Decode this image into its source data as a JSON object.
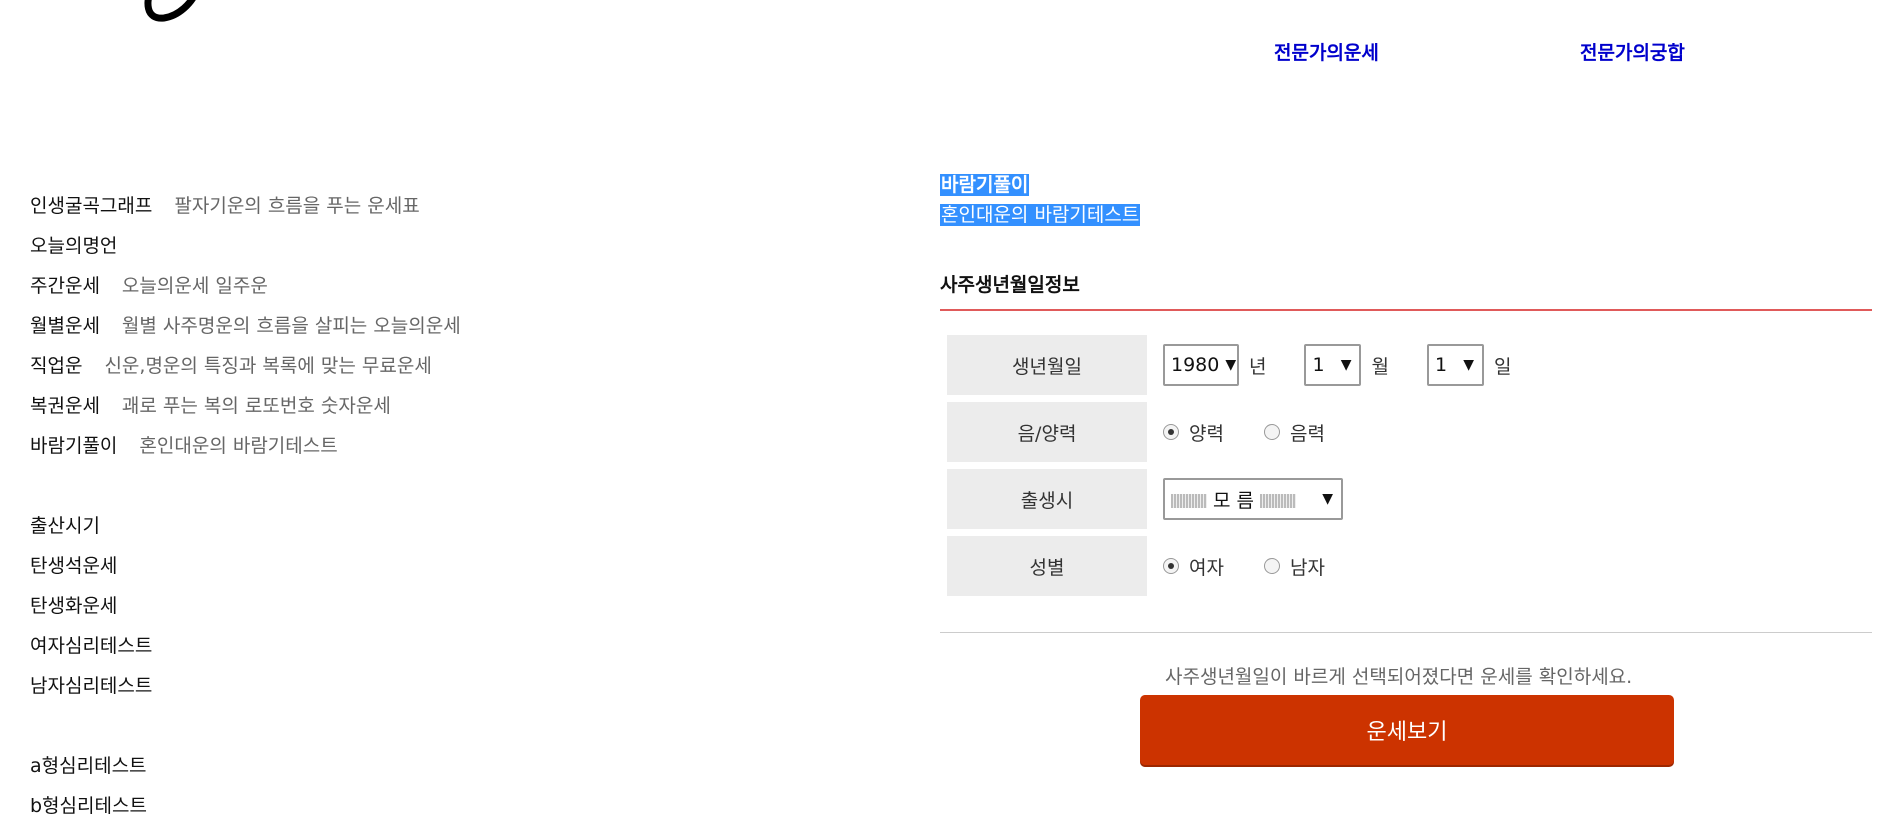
{
  "top_nav": [
    "전문가의운세",
    "전문가의궁합"
  ],
  "menu_group1": [
    {
      "title": "인생굴곡그래프",
      "desc": "팔자기운의 흐름을 푸는 운세표"
    },
    {
      "title": "오늘의명언",
      "desc": ""
    },
    {
      "title": "주간운세",
      "desc": "오늘의운세 일주운"
    },
    {
      "title": "월별운세",
      "desc": "월별 사주명운의 흐름을 살피는 오늘의운세"
    },
    {
      "title": "직업운",
      "desc": "신운,명운의 특징과 복록에 맞는 무료운세"
    },
    {
      "title": "복권운세",
      "desc": "괘로 푸는 복의 로또번호 숫자운세"
    },
    {
      "title": "바람기풀이",
      "desc": "혼인대운의 바람기테스트"
    }
  ],
  "menu_group2": [
    "출산시기",
    "탄생석운세",
    "탄생화운세",
    "여자심리테스트",
    "남자심리테스트"
  ],
  "menu_group3": [
    "a형심리테스트",
    "b형심리테스트"
  ],
  "selected": {
    "title": "바람기풀이",
    "desc": "혼인대운의 바람기테스트"
  },
  "form": {
    "section_title": "사주생년월일정보",
    "birth_label": "생년월일",
    "year_value": "1980",
    "year_unit": "년",
    "month_value": "1",
    "month_unit": "월",
    "day_value": "1",
    "day_unit": "일",
    "calendar_label": "음/양력",
    "calendar_options": [
      "양력",
      "음력"
    ],
    "calendar_selected": "양력",
    "time_label": "출생시",
    "time_value": "모 름",
    "gender_label": "성별",
    "gender_options": [
      "여자",
      "남자"
    ],
    "gender_selected": "여자"
  },
  "notice": "사주생년월일이 바르게 선택되어졌다면 운세를 확인하세요.",
  "submit_label": "운세보기",
  "colors": {
    "nav_link": "#0000cc",
    "highlight": "#3390ff",
    "button": "#cc3300",
    "section_rule": "#e05a5a"
  }
}
